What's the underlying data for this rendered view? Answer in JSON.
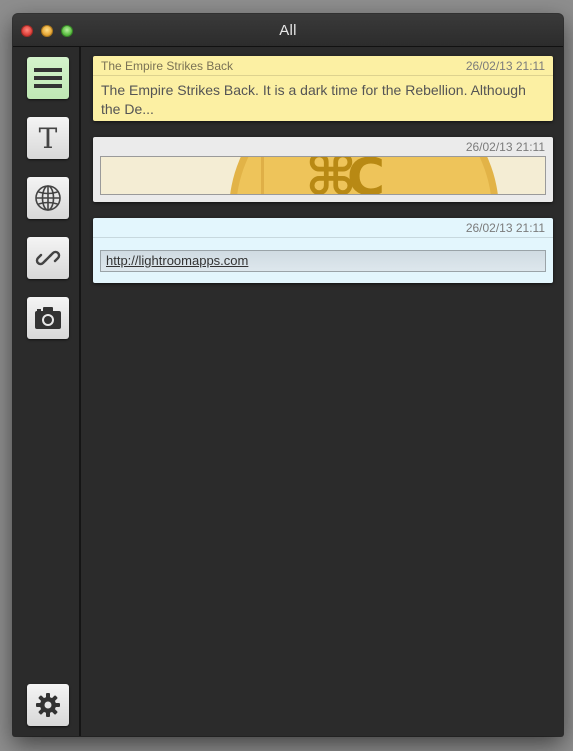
{
  "window": {
    "title": "All"
  },
  "sidebar": {
    "items": [
      {
        "name": "all",
        "icon": "list-icon",
        "active": true
      },
      {
        "name": "text",
        "icon": "text-icon",
        "active": false
      },
      {
        "name": "web",
        "icon": "globe-icon",
        "active": false
      },
      {
        "name": "link",
        "icon": "link-icon",
        "active": false
      },
      {
        "name": "image",
        "icon": "camera-icon",
        "active": false
      }
    ],
    "settings_icon": "gear-icon"
  },
  "cards": [
    {
      "type": "text",
      "title": "The Empire Strikes Back",
      "date": "26/02/13 21:11",
      "body": "The Empire Strikes Back. It is a dark time for the Rebellion. Although the De...",
      "color": "#fcf0a3"
    },
    {
      "type": "image",
      "date": "26/02/13 21:11",
      "color": "#ebebeb"
    },
    {
      "type": "link",
      "date": "26/02/13 21:11",
      "url": "http://lightroomapps.com",
      "color": "#e3f6fd"
    }
  ],
  "colors": {
    "background": "#2b2b2b",
    "active_tab": "#c9eec0"
  }
}
